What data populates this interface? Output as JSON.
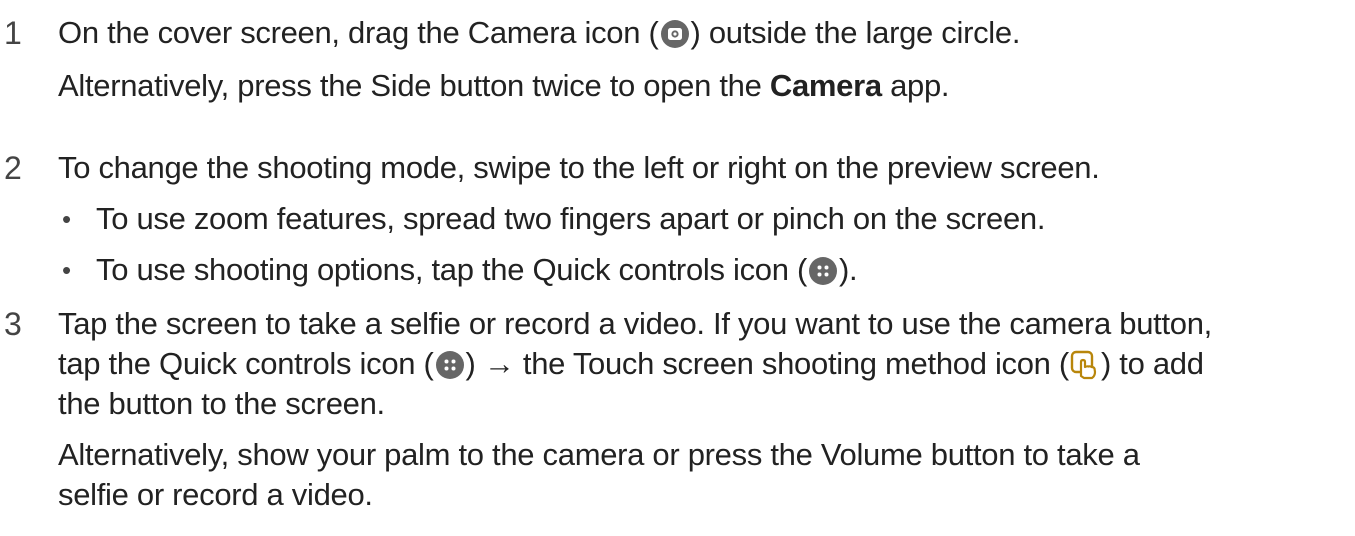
{
  "step1": {
    "number": "1",
    "line1_a": "On the cover screen, drag the Camera icon (",
    "line1_icon": "camera-icon",
    "line1_b": ") outside the large circle.",
    "line2_a": "Alternatively, press the Side button twice to open the ",
    "line2_bold": "Camera",
    "line2_b": " app."
  },
  "step2": {
    "number": "2",
    "line1": "To change the shooting mode, swipe to the left or right on the preview screen.",
    "bullets": [
      {
        "dot": "•",
        "text": "To use zoom features, spread two fingers apart or pinch on the screen."
      },
      {
        "dot": "•",
        "text_a": "To use shooting options, tap the Quick controls icon (",
        "icon": "quick-controls-icon",
        "text_b": ")."
      }
    ]
  },
  "step3": {
    "number": "3",
    "line1": "Tap the screen to take a selfie or record a video. If you want to use the camera button,",
    "line2_a": "tap the Quick controls icon (",
    "line2_icon1": "quick-controls-icon",
    "line2_mid": ") → the Touch screen shooting method icon (",
    "line2_icon2": "touch-shooting-icon",
    "line2_b": ") to add",
    "line3": "the button to the screen.",
    "line4": "Alternatively, show your palm to the camera or press the Volume button to take a",
    "line5": "selfie or record a video."
  },
  "colors": {
    "text": "#222222",
    "icon_grey": "#666666",
    "icon_gold": "#b8860b"
  }
}
